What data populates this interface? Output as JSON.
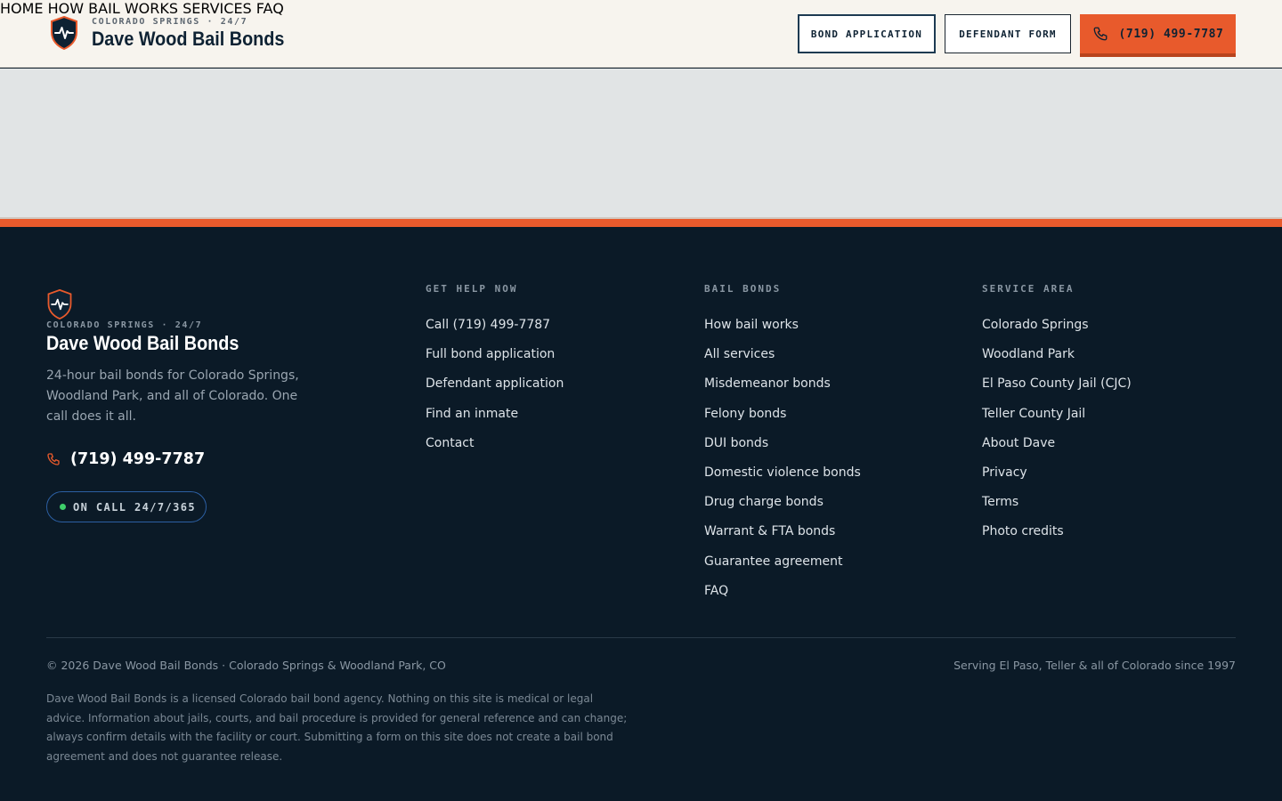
{
  "header": {
    "brand_kicker": "COLORADO SPRINGS · 24/7",
    "brand_name": "Dave Wood Bail Bonds",
    "nav": [
      "HOME",
      "HOW BAIL WORKS",
      "SERVICES",
      "FAQ"
    ],
    "bond_application_label": "BOND APPLICATION",
    "defendant_form_label": "DEFENDANT FORM",
    "call_label": "(719) 499-7787"
  },
  "footer": {
    "brand_kicker": "COLORADO SPRINGS · 24/7",
    "brand_name": "Dave Wood Bail Bonds",
    "tagline": "24-hour bail bonds for Colorado Springs, Woodland Park, and all of Colorado. One call does it all.",
    "phone": "(719) 499-7787",
    "on_call": "ON CALL 24/7/365",
    "columns": [
      {
        "heading": "GET HELP NOW",
        "links": [
          "Call (719) 499-7787",
          "Full bond application",
          "Defendant application",
          "Find an inmate",
          "Contact"
        ]
      },
      {
        "heading": "BAIL BONDS",
        "links": [
          "How bail works",
          "All services",
          "Misdemeanor bonds",
          "Felony bonds",
          "DUI bonds",
          "Domestic violence bonds",
          "Drug charge bonds",
          "Warrant & FTA bonds",
          "Guarantee agreement",
          "FAQ"
        ]
      },
      {
        "heading": "SERVICE AREA",
        "links": [
          "Colorado Springs",
          "Woodland Park",
          "El Paso County Jail (CJC)",
          "Teller County Jail",
          "About Dave",
          "Privacy",
          "Terms",
          "Photo credits"
        ]
      }
    ],
    "copyright": "© 2026 Dave Wood Bail Bonds · Colorado Springs & Woodland Park, CO",
    "since": "Serving El Paso, Teller & all of Colorado since 1997",
    "disclaimer": "Dave Wood Bail Bonds is a licensed Colorado bail bond agency. Nothing on this site is medical or legal advice. Information about jails, courts, and bail procedure is provided for general reference and can change; always confirm details with the facility or court. Submitting a form on this site does not create a bail bond agreement and does not guarantee release."
  },
  "colors": {
    "accent": "#e85a2c",
    "navy": "#0b1a27",
    "cream": "#f7f4ee",
    "status_green": "#3ecf6a"
  },
  "icons": [
    "shield-pulse-icon",
    "phone-icon",
    "status-dot-icon"
  ]
}
